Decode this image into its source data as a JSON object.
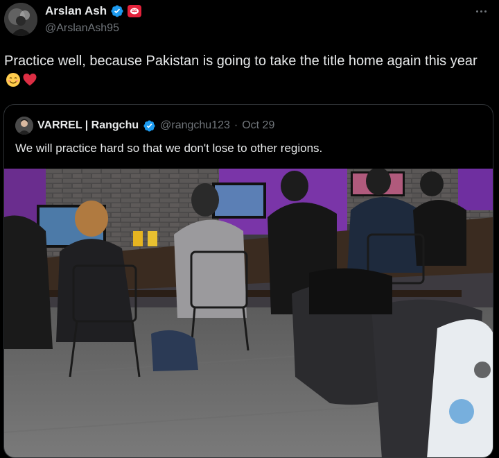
{
  "author": {
    "display_name": "Arslan Ash",
    "handle": "@ArslanAsh95",
    "verified_icon": "verified-badge-icon",
    "affiliate_icon": "affiliate-badge-icon"
  },
  "tweet": {
    "text": "Practice well, because Pakistan is going to take the title home again this year",
    "emojis": [
      "smiling-face-icon",
      "red-heart-icon"
    ]
  },
  "quoted": {
    "display_name": "VARREL | Rangchu",
    "handle": "@rangchu123",
    "separator": "·",
    "date": "Oct 29",
    "text": "We will practice hard so that we don't lose to other regions.",
    "media_description_icon": "photo-icon"
  },
  "colors": {
    "background": "#000000",
    "text": "#e7e9ea",
    "secondary_text": "#71767b",
    "border": "#2f3336",
    "verified_blue": "#1d9bf0",
    "heart_red": "#e0245e"
  }
}
